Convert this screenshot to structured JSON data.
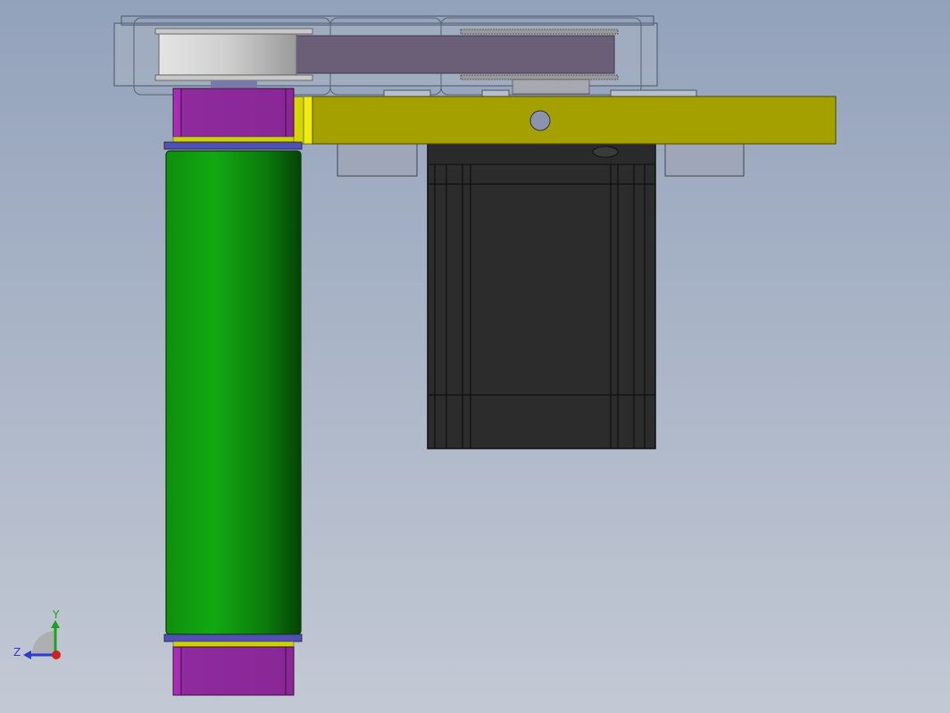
{
  "viewport": {
    "background_top": "#93a2bb",
    "background_bottom": "#c3c9d4"
  },
  "triad": {
    "y_label": "Y",
    "z_label": "Z",
    "colors": {
      "x": "#d21f1f",
      "y": "#1aa31a",
      "z": "#2a3dd0"
    }
  },
  "model": {
    "colors": {
      "roller": "#10a010",
      "roller_dark": "#0a4e0a",
      "bearing_block": "#9a2aa8",
      "bracket": "#a3a000",
      "bracket_edge": "#d9d500",
      "motor": "#2c2c2c",
      "motor_edge": "#0f0f0f",
      "belt": "#6b5f77",
      "pulley": "#d8d8d8",
      "washer": "#4f50b4",
      "cover_glass": "#aab3c3",
      "mount_block": "#9ea6b8"
    }
  }
}
